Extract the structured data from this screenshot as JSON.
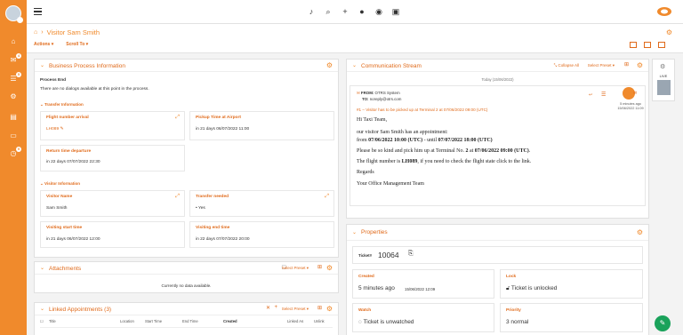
{
  "sidebar": {
    "badges": [
      "4",
      "5",
      "9"
    ]
  },
  "breadcrumb": {
    "title": "Visitor Sam Smith"
  },
  "subnav": {
    "actions": "Actions",
    "scroll_to": "Scroll To"
  },
  "bpi": {
    "title": "Business Process Information",
    "process_end_label": "Process End",
    "process_end_text": "There are no dialogs available at this point in the process.",
    "transfer_info": "Transfer Information",
    "visitor_info": "Visitor Information",
    "fields": {
      "flight_label": "Flight number arrival",
      "flight_value": "LH089",
      "pickup_label": "Pickup Time at Airport",
      "pickup_value": "in 21 days 06/07/2022 11:00",
      "return_label": "Return time departure",
      "return_value": "in 22 days 07/07/2022 22:30",
      "visitor_name_label": "Visitor Name",
      "visitor_name_value": "Sam Smith",
      "transfer_needed_label": "Transfer needed",
      "transfer_needed_value": "Yes",
      "vstart_label": "Visiting start time",
      "vstart_value": "in 21 days 06/07/2022 12:00",
      "vend_label": "Visiting end time",
      "vend_value": "in 22 days 07/07/2022 20:00"
    }
  },
  "attachments": {
    "title": "Attachments",
    "select_preset": "Select Preset",
    "empty": "Currently no data available."
  },
  "linked": {
    "title": "Linked Appointments (3)",
    "select_preset": "Select Preset",
    "columns": [
      "Title",
      "Location",
      "Start Time",
      "End Time",
      "Created",
      "Linked As",
      "Unlink"
    ]
  },
  "comm": {
    "title": "Communication Stream",
    "collapse_all": "Collapse All",
    "select_preset": "Select Preset",
    "date": "Today (15/06/2022)",
    "from_label": "FROM:",
    "from_value": "OTRS System",
    "to_label": "TO:",
    "to_value": "noreply@otrs.com",
    "subject": "#1 – Visitor has to be picked up at Terminal 2 at 07/06/2022 09:00 (UTC)",
    "time_ago": "5 minutes ago",
    "timestamp": "15/06/2022 11:09",
    "body": {
      "greet": "Hi Taxi Team,",
      "line1": "our visitor Sam Smith has an appointment:",
      "line2_pre": "from ",
      "line2_b1": "07/06/2022 10:00 (UTC)",
      "line2_mid": " - until ",
      "line2_b2": "07/07/2022 18:00 (UTC)",
      "line3_pre": "Please be so kind and pick him up at Terminal No. ",
      "line3_b1": "2",
      "line3_mid": " at ",
      "line3_b2": "07/06/2022 09:00 (UTC)",
      "line3_end": ".",
      "line4_pre": "The flight number is ",
      "line4_b": "LH089",
      "line4_end": ", if you need to check the flight state click to the link.",
      "regards": "Regards",
      "team": "Your Office Management Team"
    }
  },
  "rail": {
    "label": "LIVE"
  },
  "properties": {
    "title": "Properties",
    "ticket_label": "Ticket#",
    "ticket_value": "10064",
    "created_label": "Created",
    "created_value": "5 minutes ago",
    "created_ts": "15/06/2022 12:09",
    "lock_label": "Lock",
    "lock_value": "Ticket is unlocked",
    "watch_label": "Watch",
    "watch_value": "Ticket is unwatched",
    "priority_label": "Priority",
    "priority_value": "3 normal"
  },
  "colors": {
    "accent": "#f08a2c",
    "accent_dark": "#e06a1a",
    "chat": "#1aa25b"
  }
}
